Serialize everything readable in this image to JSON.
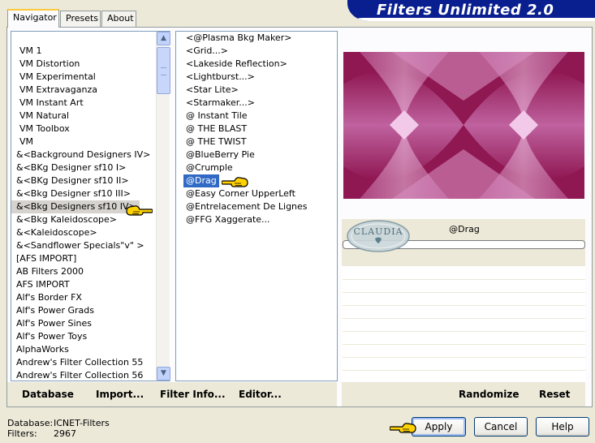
{
  "app": {
    "title": "Filters Unlimited 2.0"
  },
  "tabs": [
    {
      "label": "Navigator",
      "active": true
    },
    {
      "label": "Presets"
    },
    {
      "label": "About"
    }
  ],
  "categories": [
    "VM 1",
    "VM Distortion",
    "VM Experimental",
    "VM Extravaganza",
    "VM Instant Art",
    "VM Natural",
    "VM Toolbox",
    "VM",
    "&<Background Designers IV>",
    "&<BKg Designer sf10 I>",
    "&<BKg Designer sf10 II>",
    "&<Bkg Designer sf10 III>",
    "&<Bkg Designers sf10 IV>",
    "&<Bkg Kaleidoscope>",
    "&<Kaleidoscope>",
    "&<Sandflower Specials\"v\" >",
    "[AFS IMPORT]",
    "AB Filters 2000",
    "AFS IMPORT",
    "Alf's Border FX",
    "Alf's Power Grads",
    "Alf's Power Sines",
    "Alf's Power Toys",
    "AlphaWorks",
    "Andrew's Filter Collection 55",
    "Andrew's Filter Collection 56"
  ],
  "selected_category_index": 12,
  "filters": [
    "<@Plasma Bkg Maker>",
    "<Grid...>",
    "<Lakeside Reflection>",
    "<Lightburst...>",
    "<Star Lite>",
    "<Starmaker...>",
    "@ Instant Tile",
    "@ THE BLAST",
    "@ THE TWIST",
    "@BlueBerry Pie",
    "@Crumple",
    "@Drag",
    "@Easy Corner UpperLeft",
    "@Entrelacement De Lignes",
    "@FFG Xaggerate..."
  ],
  "selected_filter_index": 11,
  "parameters": {
    "filter_name": "@Drag"
  },
  "logo_text": "CLAUDIA",
  "toolbar": {
    "database_label": "Database",
    "import_label": "Import...",
    "filter_info_label": "Filter Info...",
    "editor_label": "Editor...",
    "randomize_label": "Randomize",
    "reset_label": "Reset"
  },
  "status": {
    "database_label": "Database:",
    "database_value": "ICNET-Filters",
    "filters_label": "Filters:",
    "filters_value": "2967"
  },
  "buttons": {
    "apply": "Apply",
    "cancel": "Cancel",
    "help": "Help"
  },
  "colors": {
    "banner": "#0a1f8f",
    "selection": "#316ac5",
    "preview_dark": "#8f1752",
    "preview_light": "#e9b3d9"
  }
}
